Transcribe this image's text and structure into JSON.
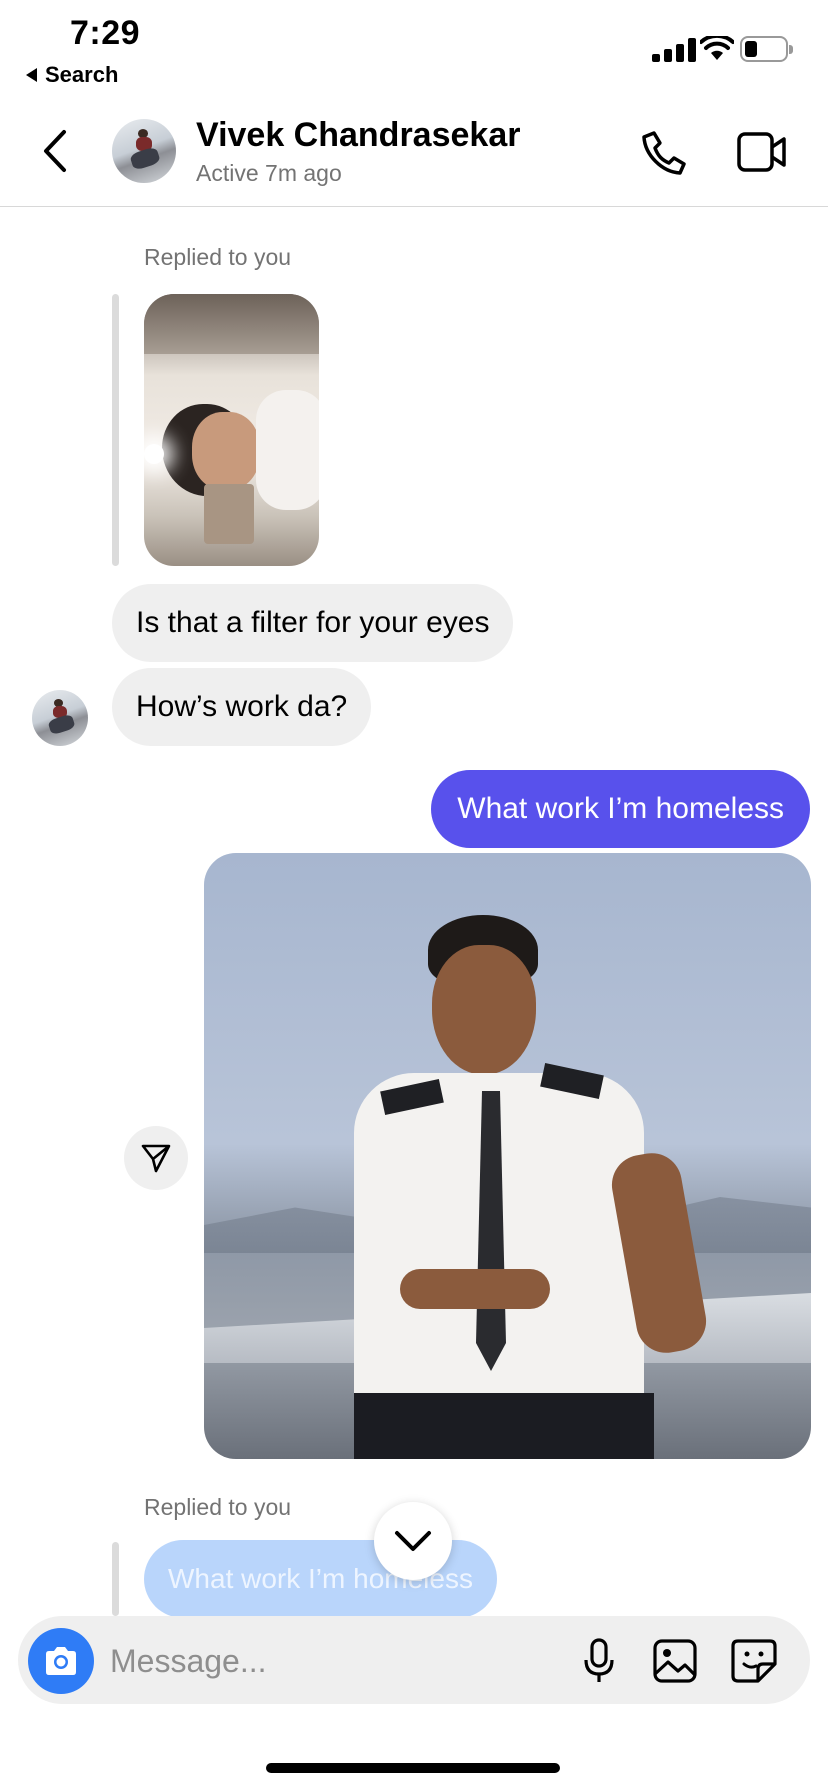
{
  "status_bar": {
    "time": "7:29",
    "back_app_label": "Search",
    "battery_level": 0.3
  },
  "header": {
    "contact_name": "Vivek Chandrasekar",
    "active_status": "Active 7m ago",
    "back_icon": "chevron-left-icon",
    "call_icon": "phone-icon",
    "video_icon": "video-icon"
  },
  "messages": {
    "reply_meta_1": "Replied to you",
    "incoming_1": "Is that a filter for your eyes",
    "incoming_2": "How’s work da?",
    "outgoing_1": "What work I’m homeless",
    "reply_meta_2": "Replied to you",
    "replied_quote": "What work I’m homeless"
  },
  "composer": {
    "placeholder": "Message...",
    "camera_icon": "camera-icon",
    "mic_icon": "microphone-icon",
    "gallery_icon": "image-icon",
    "sticker_icon": "sticker-icon"
  },
  "colors": {
    "outgoing_bubble": "#5851ec",
    "incoming_bubble": "#efefef",
    "camera_button": "#2f7cf6",
    "faded_reply_bubble": "#b9d5fb"
  }
}
